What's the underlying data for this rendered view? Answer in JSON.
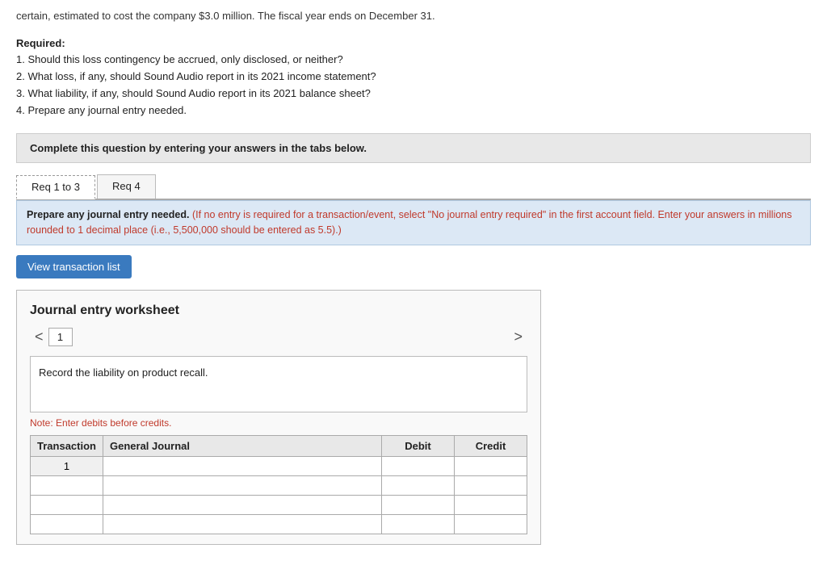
{
  "top_text": "certain, estimated to cost the company $3.0 million. The fiscal year ends on December 31.",
  "required": {
    "title": "Required:",
    "items": [
      "1. Should this loss contingency be accrued, only disclosed, or neither?",
      "2. What loss, if any, should Sound Audio report in its 2021 income statement?",
      "3. What liability, if any, should Sound Audio report in its 2021 balance sheet?",
      "4. Prepare any journal entry needed."
    ]
  },
  "complete_box": {
    "text": "Complete this question by entering your answers in the tabs below."
  },
  "tabs": [
    {
      "label": "Req 1 to 3",
      "active": true
    },
    {
      "label": "Req 4",
      "active": false
    }
  ],
  "instruction": {
    "main": "Prepare any journal entry needed.",
    "red": " (If no entry is required for a transaction/event, select \"No journal entry required\" in the first account field. Enter your answers in millions rounded to 1 decimal place (i.e., 5,500,000 should be entered as 5.5).)"
  },
  "btn_view": "View transaction list",
  "worksheet": {
    "title": "Journal entry worksheet",
    "nav_left": "<",
    "nav_right": ">",
    "current_page": "1",
    "record_label": "Record the liability on product recall.",
    "note": "Note: Enter debits before credits.",
    "table": {
      "headers": [
        "Transaction",
        "General Journal",
        "Debit",
        "Credit"
      ],
      "rows": [
        {
          "transaction": "1",
          "general_journal": "",
          "debit": "",
          "credit": ""
        },
        {
          "transaction": "",
          "general_journal": "",
          "debit": "",
          "credit": ""
        },
        {
          "transaction": "",
          "general_journal": "",
          "debit": "",
          "credit": ""
        },
        {
          "transaction": "",
          "general_journal": "",
          "debit": "",
          "credit": ""
        }
      ]
    }
  }
}
